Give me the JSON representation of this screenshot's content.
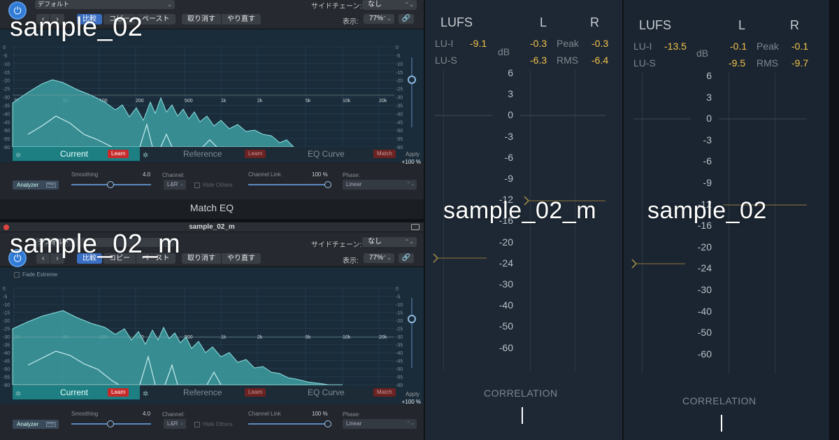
{
  "overlays": {
    "top_left": "sample_02",
    "bottom_left": "sample_02_m",
    "meter_left": "sample_02_m",
    "meter_right": "sample_02"
  },
  "app_title": "Match EQ",
  "panel_bottom": {
    "window_title": "sample_02_m",
    "fade_extreme": "Fade Extreme"
  },
  "toolbar": {
    "preset": "デフォルト",
    "sidechain_label": "サイドチェーン:",
    "sidechain_value": "なし",
    "nav_back": "‹",
    "nav_forward": "›",
    "compare": "比較",
    "copy": "コピー",
    "paste": "ペースト",
    "undo": "取り消す",
    "redo": "やり直す",
    "view_label": "表示:",
    "zoom": "77%",
    "link_icon": "link-icon"
  },
  "eq": {
    "db_ticks": [
      "0",
      "-5",
      "-10",
      "-15",
      "-20",
      "-25",
      "-30",
      "-35",
      "-40",
      "-45",
      "-50",
      "-55",
      "-60"
    ],
    "freq_ticks": [
      "20",
      "50",
      "100",
      "200",
      "500",
      "1k",
      "2k",
      "5k",
      "10k",
      "20k"
    ],
    "tabs": {
      "current": "Current",
      "reference": "Reference",
      "eq_curve": "EQ Curve"
    },
    "learn": "Learn",
    "match": "Match",
    "apply_label": "Apply",
    "apply_value": "+100 %"
  },
  "controls": {
    "analyzer": "Analyzer",
    "pre": "PRE",
    "smoothing_label": "Smoothing",
    "smoothing_value": "4.0",
    "channel_label": "Channel:",
    "channel_value": "L&R",
    "hide_others": "Hide Others",
    "channel_link_label": "Channel Link",
    "channel_link_value": "100 %",
    "phase_label": "Phase:",
    "phase_value": "Linear"
  },
  "meters": [
    {
      "lufs": "LUFS",
      "l": "L",
      "r": "R",
      "db": "dB",
      "lu_i_label": "LU-I",
      "lu_i": "-9.1",
      "lu_s_label": "LU-S",
      "peak_label": "Peak",
      "peak_l": "-0.3",
      "peak_r": "-0.3",
      "rms_label": "RMS",
      "rms_l": "-6.3",
      "rms_r": "-6.4",
      "correlation": "CORRELATION"
    },
    {
      "lufs": "LUFS",
      "l": "L",
      "r": "R",
      "db": "dB",
      "lu_i_label": "LU-I",
      "lu_i": "-13.5",
      "lu_s_label": "LU-S",
      "peak_label": "Peak",
      "peak_l": "-0.1",
      "peak_r": "-0.1",
      "rms_label": "RMS",
      "rms_l": "-9.5",
      "rms_r": "-9.7",
      "correlation": "CORRELATION"
    }
  ],
  "meter_scale": [
    "6",
    "3",
    "0",
    "-3",
    "-6",
    "-9",
    "-12",
    "-16",
    "-20",
    "-24",
    "-30",
    "-40",
    "-50",
    "-60"
  ],
  "colors": {
    "accent": "#2f7bd6",
    "teal": "#1e7f82",
    "meter_value": "#f3c24a",
    "learn_red": "#c72a2a"
  }
}
